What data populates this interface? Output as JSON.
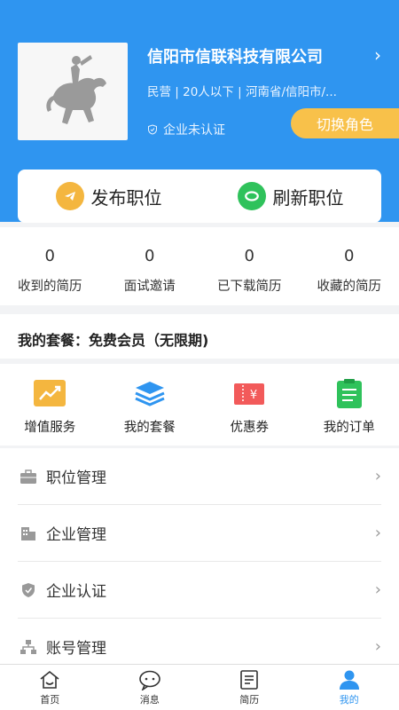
{
  "company": {
    "name": "信阳市信联科技有限公司",
    "chevron": "›",
    "meta": "民营 | 20人以下 | 河南省/信阳市/...",
    "certification": "企业未认证",
    "switch_role": "切换角色"
  },
  "actions": [
    {
      "label": "发布职位",
      "icon": "paper-plane-icon",
      "color": "#f4b63f"
    },
    {
      "label": "刷新职位",
      "icon": "refresh-icon",
      "color": "#2fc25b"
    }
  ],
  "stats": [
    {
      "value": "0",
      "label": "收到的简历"
    },
    {
      "value": "0",
      "label": "面试邀请"
    },
    {
      "value": "0",
      "label": "已下载简历"
    },
    {
      "value": "0",
      "label": "收藏的简历"
    }
  ],
  "package": {
    "title": "我的套餐：免费会员（无限期)"
  },
  "services": [
    {
      "label": "增值服务",
      "icon": "trend-chart-icon",
      "color": "#f4b63f"
    },
    {
      "label": "我的套餐",
      "icon": "layers-icon",
      "color": "#2f95f0"
    },
    {
      "label": "优惠券",
      "icon": "coupon-icon",
      "color": "#f25a5a"
    },
    {
      "label": "我的订单",
      "icon": "clipboard-icon",
      "color": "#2fc25b"
    }
  ],
  "menu": [
    {
      "label": "职位管理",
      "icon": "briefcase-icon"
    },
    {
      "label": "企业管理",
      "icon": "building-icon"
    },
    {
      "label": "企业认证",
      "icon": "shield-icon"
    },
    {
      "label": "账号管理",
      "icon": "org-chart-icon"
    }
  ],
  "menu_chevron": "›",
  "tabs": [
    {
      "label": "首页",
      "icon": "home-icon"
    },
    {
      "label": "消息",
      "icon": "message-icon"
    },
    {
      "label": "简历",
      "icon": "resume-icon"
    },
    {
      "label": "我的",
      "icon": "user-icon",
      "active": true
    }
  ],
  "colors": {
    "primary": "#2f95f0",
    "accent": "#f8c14a"
  }
}
